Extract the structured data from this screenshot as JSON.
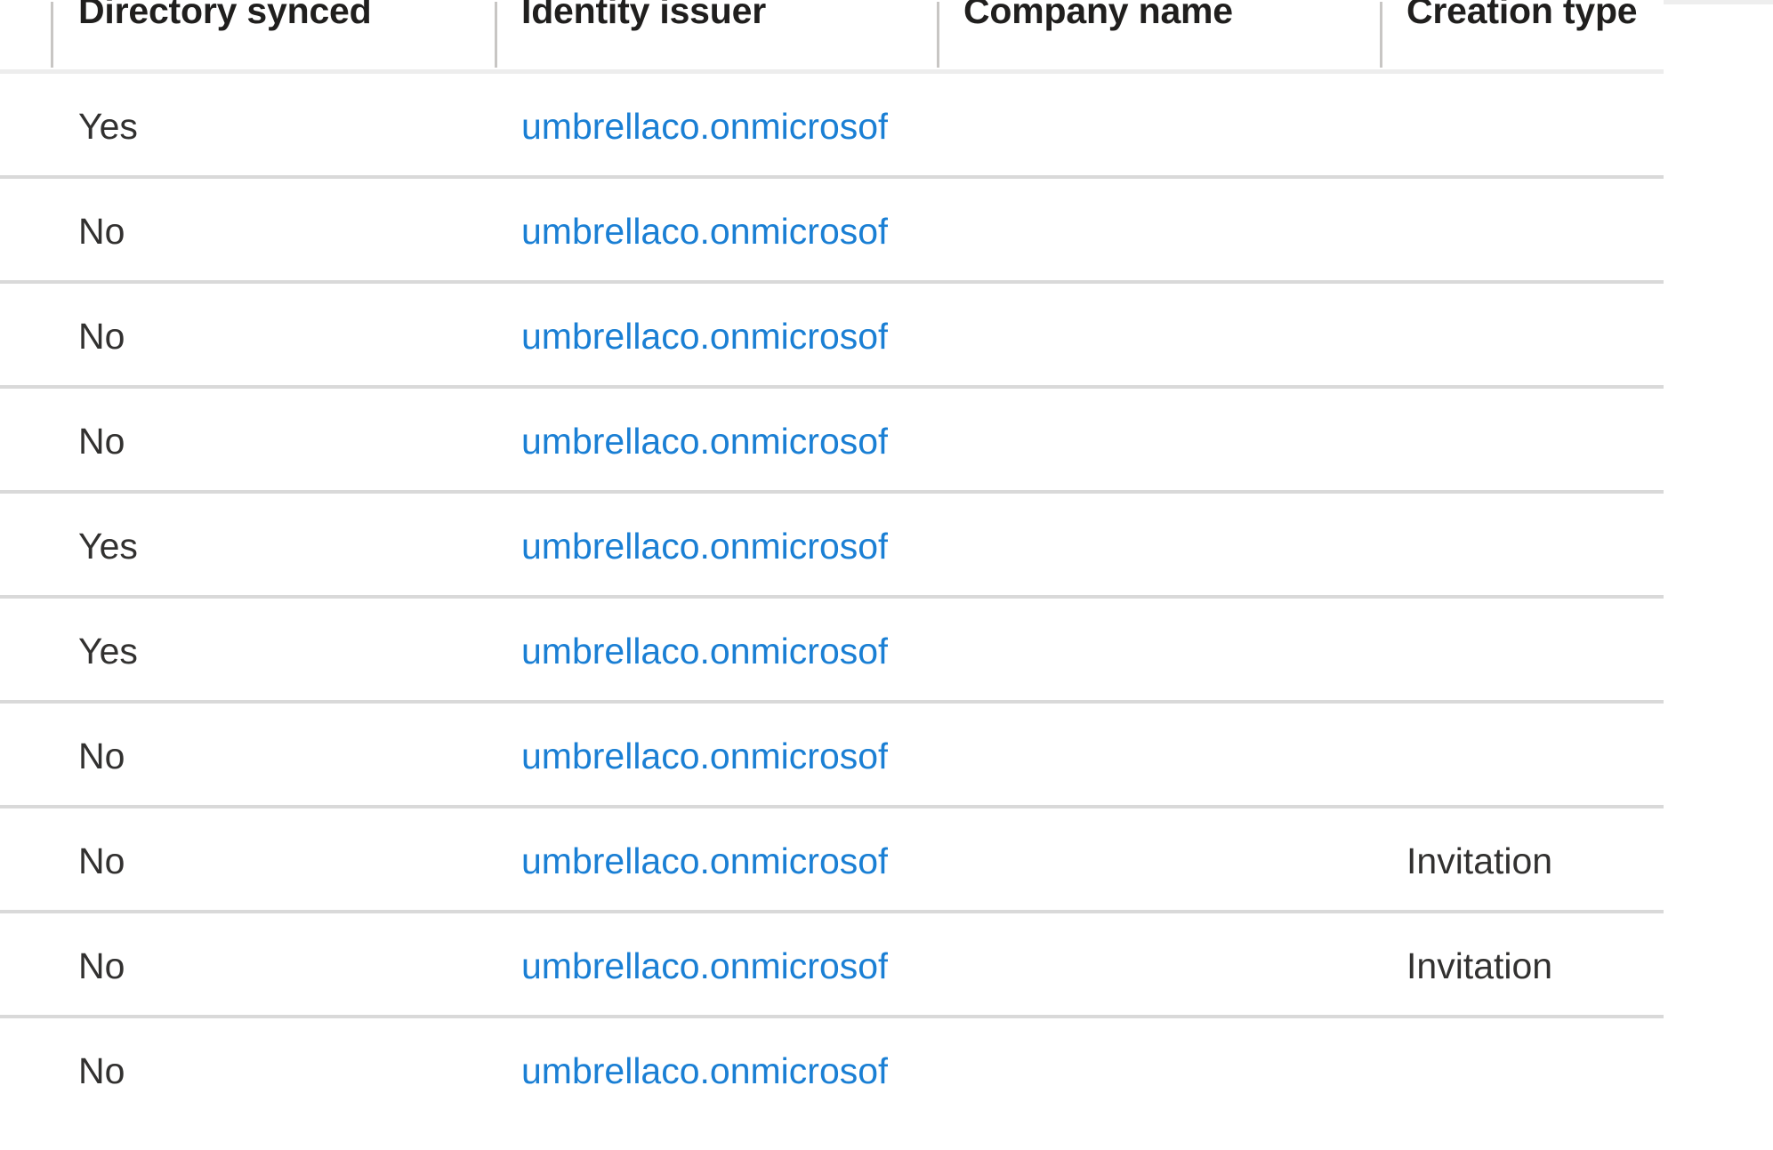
{
  "table": {
    "columns": [
      {
        "key": "directory_synced",
        "label": "Directory synced"
      },
      {
        "key": "identity_issuer",
        "label": "Identity issuer"
      },
      {
        "key": "company_name",
        "label": "Company name"
      },
      {
        "key": "creation_type",
        "label": "Creation type"
      }
    ],
    "link_color": "#1a7fd4",
    "text_color": "#323130",
    "header_color": "#201f1e",
    "separator_color": "#d9d9d9",
    "rows": [
      {
        "directory_synced": "Yes",
        "identity_issuer": "umbrellaco.onmicrosof",
        "company_name": "",
        "creation_type": ""
      },
      {
        "directory_synced": "No",
        "identity_issuer": "umbrellaco.onmicrosof",
        "company_name": "",
        "creation_type": ""
      },
      {
        "directory_synced": "No",
        "identity_issuer": "umbrellaco.onmicrosof",
        "company_name": "",
        "creation_type": ""
      },
      {
        "directory_synced": "No",
        "identity_issuer": "umbrellaco.onmicrosof",
        "company_name": "",
        "creation_type": ""
      },
      {
        "directory_synced": "Yes",
        "identity_issuer": "umbrellaco.onmicrosof",
        "company_name": "",
        "creation_type": ""
      },
      {
        "directory_synced": "Yes",
        "identity_issuer": "umbrellaco.onmicrosof",
        "company_name": "",
        "creation_type": ""
      },
      {
        "directory_synced": "No",
        "identity_issuer": "umbrellaco.onmicrosof",
        "company_name": "",
        "creation_type": ""
      },
      {
        "directory_synced": "No",
        "identity_issuer": "umbrellaco.onmicrosof",
        "company_name": "",
        "creation_type": "Invitation"
      },
      {
        "directory_synced": "No",
        "identity_issuer": "umbrellaco.onmicrosof",
        "company_name": "",
        "creation_type": "Invitation"
      },
      {
        "directory_synced": "No",
        "identity_issuer": "umbrellaco.onmicrosof",
        "company_name": "",
        "creation_type": ""
      }
    ]
  }
}
